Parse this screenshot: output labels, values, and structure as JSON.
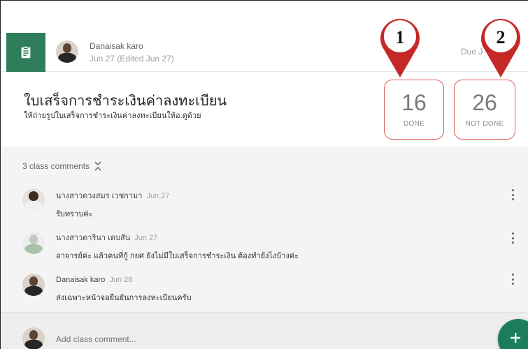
{
  "post": {
    "author": "Danaisak karo",
    "date": "Jun 27 (Edited Jun 27)",
    "due": "Due J",
    "title": "ใบเสร็จการชำระเงินค่าลงทะเบียน",
    "description": "ให้ถ่ายรูปใบเสร็จการชำระเงินค่าลงทะเบียนให้อ.ดูด้วย",
    "assignment_icon": "assignment-icon"
  },
  "stats": {
    "done_count": "16",
    "done_label": "DONE",
    "not_done_count": "26",
    "not_done_label": "NOT DONE"
  },
  "annotations": {
    "marker_1": "1",
    "marker_2": "2"
  },
  "comments": {
    "toggle_label": "3 class comments",
    "items": [
      {
        "name": "นางสาวดวงสมร เวชกามา",
        "date": "Jun 27",
        "text": "รับทราบค่ะ"
      },
      {
        "name": "นางสาวดารินา เดบสัน",
        "date": "Jun 27",
        "text": "อาจารย์ค่ะ แล้วคนที่กู้ กยศ ยังไม่มีใบเสร็จการชำระเงิน ต้องทำยังไงบ้างค่ะ"
      },
      {
        "name": "Danaisak karo",
        "date": "Jun 28",
        "text": "ส่งเฉพาะหน้าจอยืนยันการลงทะเบียนครับ"
      }
    ],
    "add_placeholder": "Add class comment..."
  },
  "colors": {
    "accent": "#2e7d5b",
    "marker_red": "#c62828",
    "stat_border": "#e06060",
    "fab": "#1b7d5c"
  }
}
